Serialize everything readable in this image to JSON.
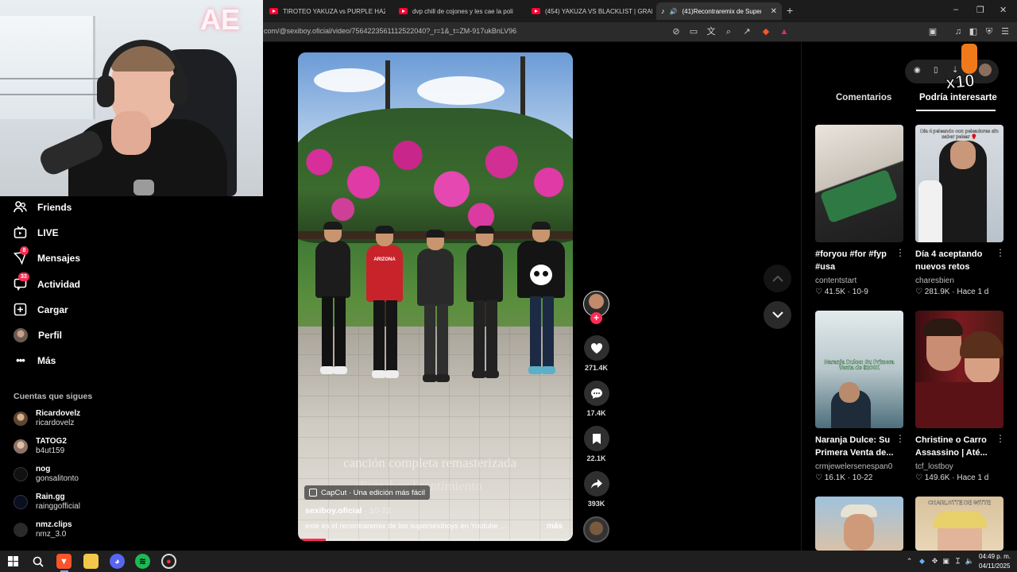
{
  "browser": {
    "tabs": [
      {
        "title": "TIROTEO YAKUZA vs PURPLE HAZE |",
        "kind": "youtube"
      },
      {
        "title": "dvp chill de cojones y les cae la poli",
        "kind": "youtube"
      },
      {
        "title": "(454) YAKUZA VS BLACKLIST | GRAFI",
        "kind": "youtube"
      },
      {
        "title": "(41)Recontraremix de Superse",
        "kind": "tiktok",
        "active": true
      }
    ],
    "url": "com/@sexiboy.oficial/video/7564223561112522040?_r=1&_t=ZM-917ukBnLV96"
  },
  "webcam": {
    "neon_sign": "AE"
  },
  "sidebar": {
    "items": [
      {
        "label": "Friends",
        "icon": "friends-icon"
      },
      {
        "label": "LIVE",
        "icon": "live-icon"
      },
      {
        "label": "Mensajes",
        "icon": "messages-icon",
        "badge": "8"
      },
      {
        "label": "Actividad",
        "icon": "activity-icon",
        "badge": "33"
      },
      {
        "label": "Cargar",
        "icon": "upload-icon"
      },
      {
        "label": "Perfil",
        "icon": "profile-avatar"
      },
      {
        "label": "Más",
        "icon": "more-icon"
      }
    ],
    "following_title": "Cuentas que sigues",
    "following": [
      {
        "name": "Ricardovelz",
        "username": "ricardovelz"
      },
      {
        "name": "TATOG2",
        "username": "b4ut159"
      },
      {
        "name": "nog",
        "username": "gonsalitonto"
      },
      {
        "name": "Rain.gg",
        "username": "rainggofficial"
      },
      {
        "name": "nmz.clips",
        "username": "nmz_3.0"
      }
    ]
  },
  "video": {
    "watermark_line1": "canción completa remasterizada",
    "watermark_line2": "@sexiboy | sentimiento",
    "capcut_label": "CapCut · Una edición más fácil",
    "author": "sexiboy.oficial",
    "date": " · 10-22",
    "description": "este es el recontraremix de los supersexiboys en Youtube ...",
    "more_label": "más",
    "progress": 0.1,
    "shirt_text": "ARIZONA"
  },
  "actions": {
    "likes": "271.4K",
    "comments": "17.4K",
    "saves": "22.1K",
    "shares": "393K"
  },
  "right_panel": {
    "tabs": [
      "Comentarios",
      "Podría interesarte"
    ],
    "active_tab": 1,
    "overlay_badge": "x10",
    "cards": [
      {
        "title": "#foryou #for #fyp #usa",
        "author": "contentstart",
        "likes": "41.5K",
        "date": "10-9",
        "overlay": ""
      },
      {
        "title": "Día 4 aceptando nuevos retos",
        "author": "charesbien",
        "likes": "281.9K",
        "date": "Hace 1 d",
        "overlay": "Día 4 peleando con peleadores sin saber pelear 🥊"
      },
      {
        "title": "Naranja Dulce: Su Primera Venta de...",
        "author": "crmjewelersenespan0",
        "likes": "16.1K",
        "date": "10-22",
        "overlay": "Naranja Dulce: Su Primera Venta de $200K"
      },
      {
        "title": "Christine o Carro Assassino | Até...",
        "author": "tcf_lostboy",
        "likes": "149.6K",
        "date": "Hace 1 d",
        "overlay": ""
      },
      {
        "title": "",
        "author": "",
        "likes": "",
        "date": "",
        "overlay": ""
      },
      {
        "title": "",
        "author": "",
        "likes": "",
        "date": "",
        "overlay": "CHARLOTTE DE WITTE"
      }
    ]
  },
  "taskbar": {
    "time": "04:49 p. m.",
    "date": "04/11/2025"
  }
}
